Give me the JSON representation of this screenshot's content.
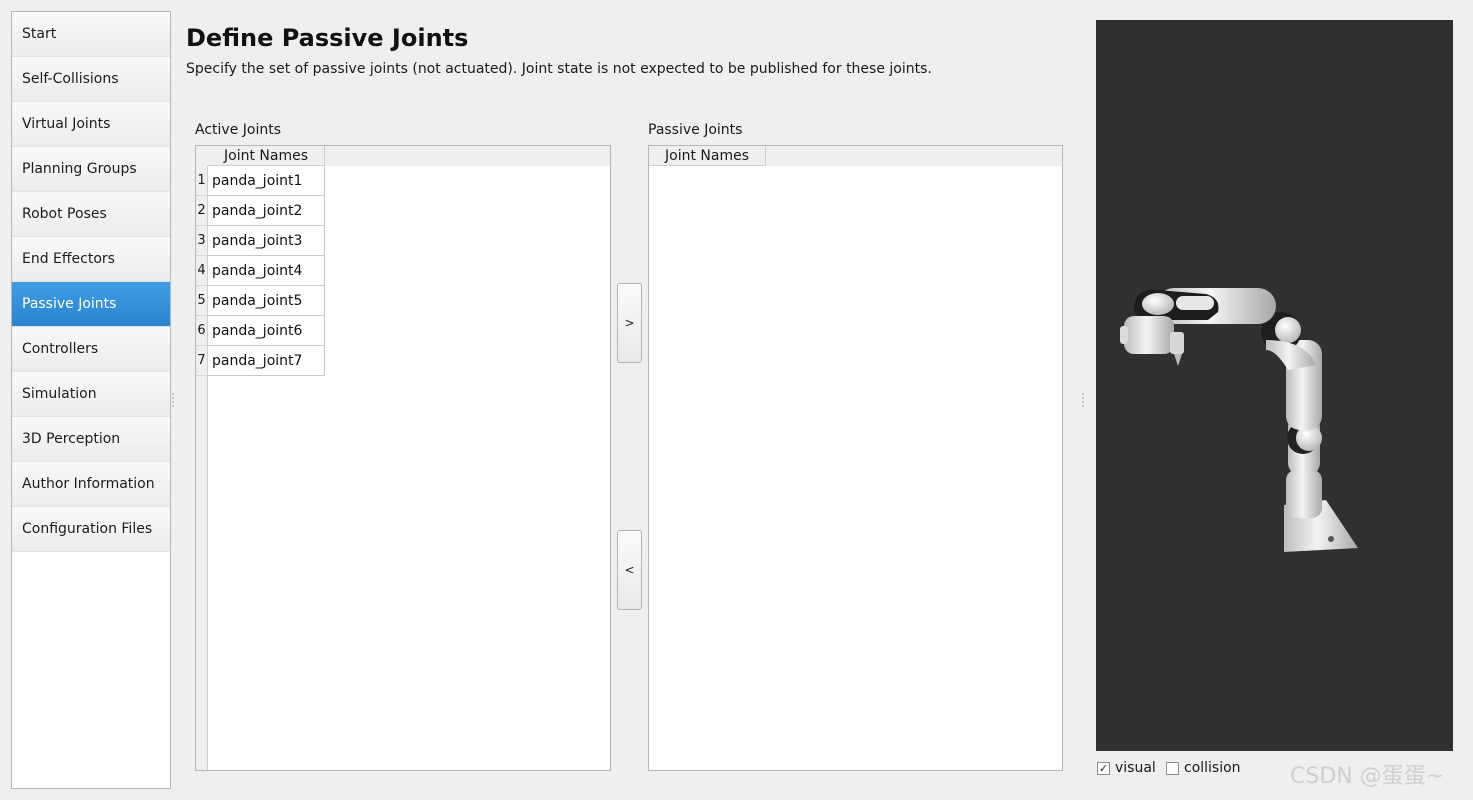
{
  "sidebar": {
    "items": [
      {
        "label": "Start"
      },
      {
        "label": "Self-Collisions"
      },
      {
        "label": "Virtual Joints"
      },
      {
        "label": "Planning Groups"
      },
      {
        "label": "Robot Poses"
      },
      {
        "label": "End Effectors"
      },
      {
        "label": "Passive Joints"
      },
      {
        "label": "Controllers"
      },
      {
        "label": "Simulation"
      },
      {
        "label": "3D Perception"
      },
      {
        "label": "Author Information"
      },
      {
        "label": "Configuration Files"
      }
    ],
    "active": "Passive Joints"
  },
  "header": {
    "title": "Define Passive Joints",
    "subtitle": "Specify the set of passive joints (not actuated). Joint state is not expected to be published for these joints."
  },
  "active_joints": {
    "label": "Active Joints",
    "column_header": "Joint Names",
    "rows": [
      {
        "num": "1",
        "name": "panda_joint1"
      },
      {
        "num": "2",
        "name": "panda_joint2"
      },
      {
        "num": "3",
        "name": "panda_joint3"
      },
      {
        "num": "4",
        "name": "panda_joint4"
      },
      {
        "num": "5",
        "name": "panda_joint5"
      },
      {
        "num": "6",
        "name": "panda_joint6"
      },
      {
        "num": "7",
        "name": "panda_joint7"
      }
    ]
  },
  "passive_joints": {
    "label": "Passive Joints",
    "column_header": "Joint Names",
    "rows": []
  },
  "buttons": {
    "move_right": ">",
    "move_left": "<"
  },
  "viewer": {
    "background": "#303030",
    "visual_label": "visual",
    "visual_checked": true,
    "collision_label": "collision",
    "collision_checked": false,
    "check_mark": "✓"
  },
  "watermark": "CSDN @蛋蛋~",
  "colors": {
    "accent": "#2a83cf",
    "window_bg": "#efefef"
  }
}
